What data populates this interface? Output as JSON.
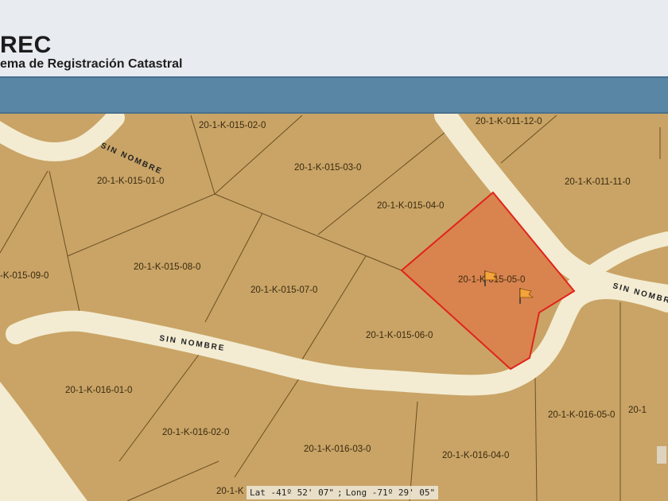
{
  "app": {
    "title": "REC",
    "subtitle": "ema de Registración Catastral"
  },
  "colors": {
    "parcel_fill": "#c9a466",
    "road_fill": "#f3ecd2",
    "selected_fill": "#d9844f",
    "selected_stroke": "#e2231a",
    "toolbar": "#5a86a6"
  },
  "icons": {
    "marker": "flag-icon"
  },
  "roads": [
    {
      "id": "road-top-left",
      "label": "SIN NOMBRE"
    },
    {
      "id": "road-center",
      "label": "SIN NOMBRE"
    },
    {
      "id": "road-right",
      "label": "SIN NOMBRE"
    }
  ],
  "parcels": [
    {
      "id": "20-1-K-015-02-0"
    },
    {
      "id": "20-1-K-011-12-0"
    },
    {
      "id": "20-1-K-015-01-0"
    },
    {
      "id": "20-1-K-015-03-0"
    },
    {
      "id": "20-1-K-011-11-0"
    },
    {
      "id": "20-1-K-015-04-0"
    },
    {
      "id": "-K-015-09-0"
    },
    {
      "id": "20-1-K-015-08-0"
    },
    {
      "id": "20-1-K-015-07-0"
    },
    {
      "id": "20-1-K-015-05-0",
      "selected": true
    },
    {
      "id": "20-1-K-015-06-0"
    },
    {
      "id": "20-1-K-016-01-0"
    },
    {
      "id": "20-1-K-016-02-0"
    },
    {
      "id": "20-1-K-016-03-0"
    },
    {
      "id": "20-1-K-016-04-0"
    },
    {
      "id": "20-1-K-016-05-0"
    },
    {
      "id": "20-1"
    },
    {
      "id": "20-1-K"
    }
  ],
  "coordinates": {
    "lat": "Lat -41º 52' 07\"",
    "separator": ";",
    "long": "Long -71º 29' 05\""
  }
}
